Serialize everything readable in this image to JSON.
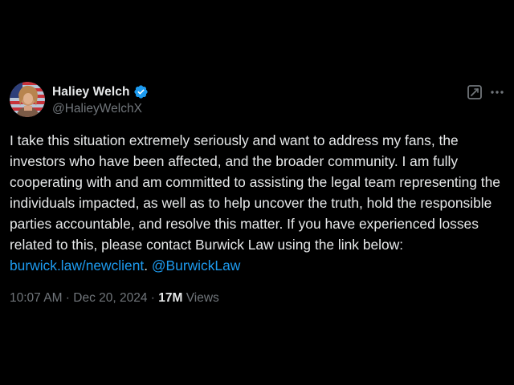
{
  "author": {
    "display_name": "Haliey Welch",
    "handle": "@HalieyWelchX",
    "verified": true,
    "avatar_icon": "avatar-flag-photo"
  },
  "actions": {
    "grok_icon": "grok-icon",
    "more_icon": "more-dots-icon"
  },
  "post": {
    "text_main": "I take this situation extremely seriously and want to address my fans, the investors who have been affected, and the broader community. I am fully cooperating with and am committed to assisting the legal team representing the individuals impacted, as well as to help uncover the truth, hold the responsible parties accountable, and resolve this matter. If you have experienced losses related to this, please contact Burwick Law using the link below: ",
    "link_url_text": "burwick.law/newclient",
    "link_separator": ". ",
    "mention": "@BurwickLaw"
  },
  "meta": {
    "time": "10:07 AM",
    "dot1": " · ",
    "date": "Dec 20, 2024",
    "dot2": " · ",
    "views_count": "17M",
    "views_label": " Views"
  },
  "colors": {
    "background": "#000000",
    "text": "#e7e9ea",
    "secondary": "#71767b",
    "link": "#1d9bf0",
    "verified": "#1d9bf0"
  }
}
